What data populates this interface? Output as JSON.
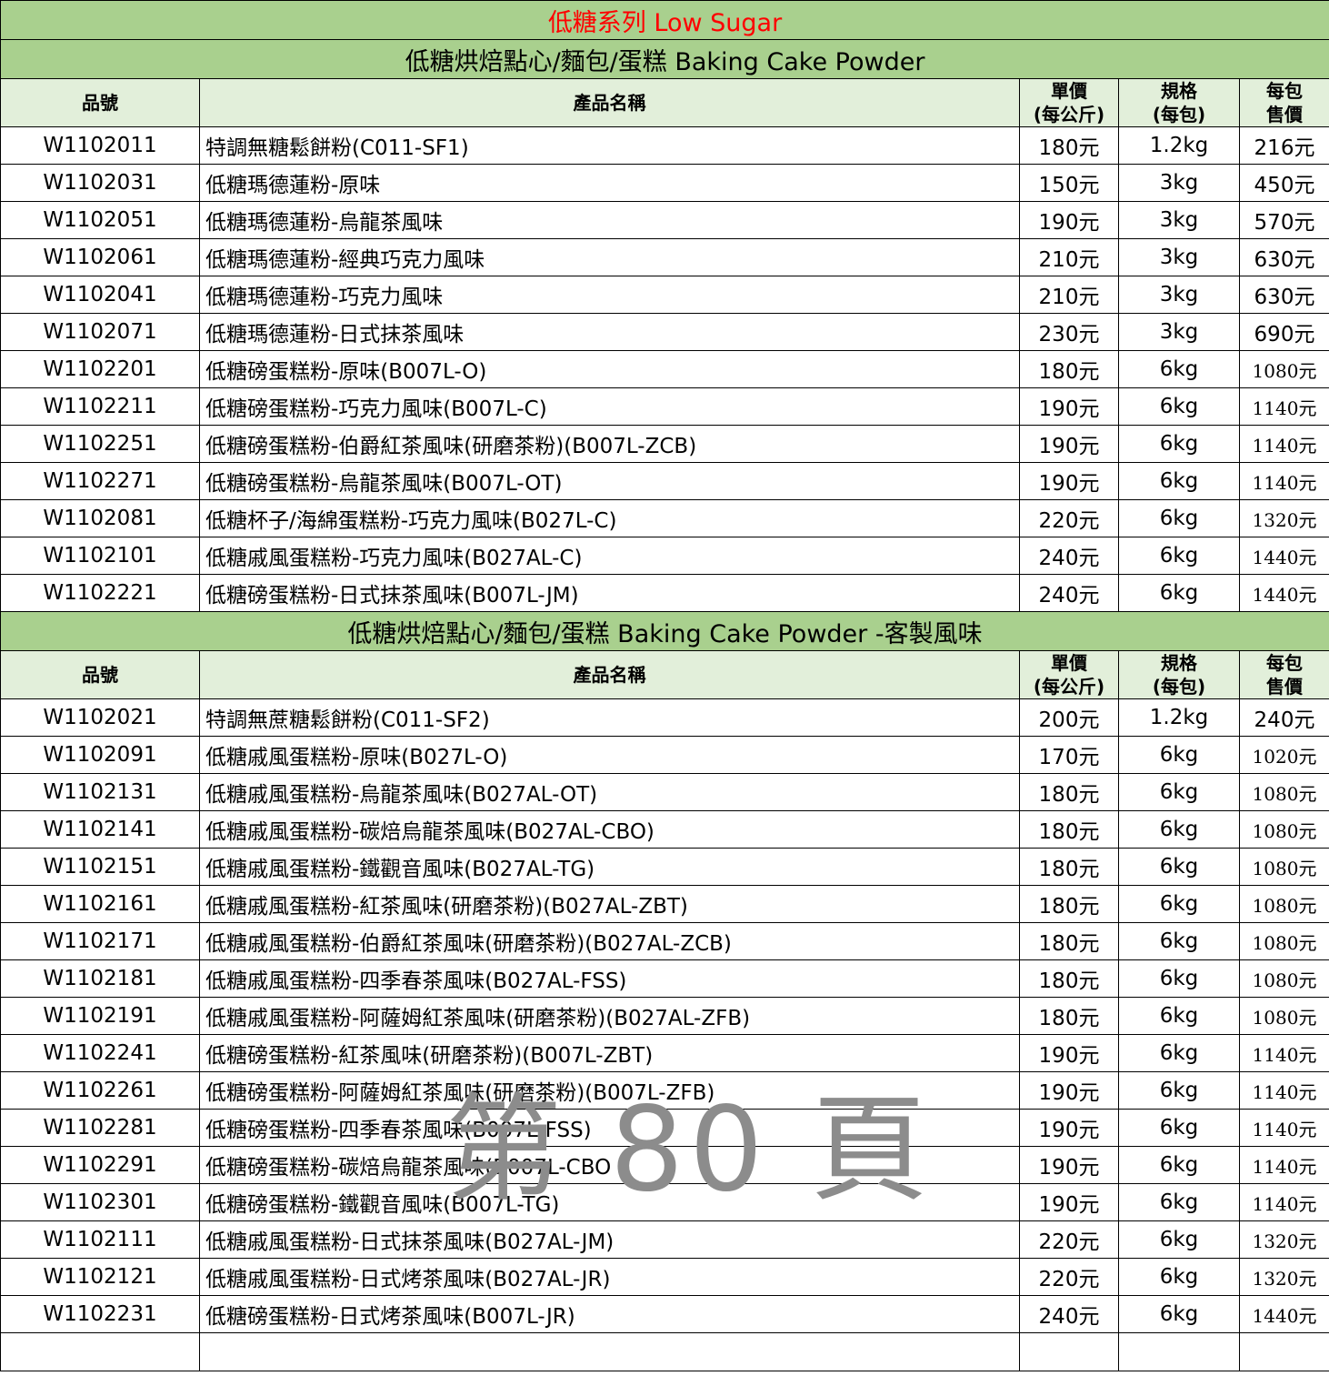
{
  "title": "低糖系列 Low Sugar",
  "columns": {
    "code": "品號",
    "name": "產品名稱",
    "unit_price_1": "單價",
    "unit_price_2": "(每公斤)",
    "spec_1": "規格",
    "spec_2": "(每包)",
    "pack_price_1": "每包",
    "pack_price_2": "售價"
  },
  "sections": [
    {
      "title": "低糖烘焙點心/麵包/蛋糕 Baking Cake Powder",
      "rows": [
        {
          "code": "W1102011",
          "name": "特調無糖鬆餅粉(C011-SF1)",
          "price": "180元",
          "spec": "1.2kg",
          "total": "216元"
        },
        {
          "code": "W1102031",
          "name": "低糖瑪德蓮粉-原味",
          "price": "150元",
          "spec": "3kg",
          "total": "450元"
        },
        {
          "code": "W1102051",
          "name": "低糖瑪德蓮粉-烏龍茶風味",
          "price": "190元",
          "spec": "3kg",
          "total": "570元"
        },
        {
          "code": "W1102061",
          "name": "低糖瑪德蓮粉-經典巧克力風味",
          "price": "210元",
          "spec": "3kg",
          "total": "630元"
        },
        {
          "code": "W1102041",
          "name": "低糖瑪德蓮粉-巧克力風味",
          "price": "210元",
          "spec": "3kg",
          "total": "630元"
        },
        {
          "code": "W1102071",
          "name": "低糖瑪德蓮粉-日式抹茶風味",
          "price": "230元",
          "spec": "3kg",
          "total": "690元"
        },
        {
          "code": "W1102201",
          "name": "低糖磅蛋糕粉-原味(B007L-O)",
          "price": "180元",
          "spec": "6kg",
          "total": "1080元"
        },
        {
          "code": "W1102211",
          "name": "低糖磅蛋糕粉-巧克力風味(B007L-C)",
          "price": "190元",
          "spec": "6kg",
          "total": "1140元"
        },
        {
          "code": "W1102251",
          "name": "低糖磅蛋糕粉-伯爵紅茶風味(研磨茶粉)(B007L-ZCB)",
          "price": "190元",
          "spec": "6kg",
          "total": "1140元"
        },
        {
          "code": "W1102271",
          "name": "低糖磅蛋糕粉-烏龍茶風味(B007L-OT)",
          "price": "190元",
          "spec": "6kg",
          "total": "1140元"
        },
        {
          "code": "W1102081",
          "name": "低糖杯子/海綿蛋糕粉-巧克力風味(B027L-C)",
          "price": "220元",
          "spec": "6kg",
          "total": "1320元"
        },
        {
          "code": "W1102101",
          "name": "低糖戚風蛋糕粉-巧克力風味(B027AL-C)",
          "price": "240元",
          "spec": "6kg",
          "total": "1440元"
        },
        {
          "code": "W1102221",
          "name": "低糖磅蛋糕粉-日式抹茶風味(B007L-JM)",
          "price": "240元",
          "spec": "6kg",
          "total": "1440元"
        }
      ]
    },
    {
      "title": "低糖烘焙點心/麵包/蛋糕 Baking Cake Powder -客製風味",
      "rows": [
        {
          "code": "W1102021",
          "name": "特調無蔗糖鬆餅粉(C011-SF2)",
          "price": "200元",
          "spec": "1.2kg",
          "total": "240元"
        },
        {
          "code": "W1102091",
          "name": "低糖戚風蛋糕粉-原味(B027L-O)",
          "price": "170元",
          "spec": "6kg",
          "total": "1020元"
        },
        {
          "code": "W1102131",
          "name": "低糖戚風蛋糕粉-烏龍茶風味(B027AL-OT)",
          "price": "180元",
          "spec": "6kg",
          "total": "1080元"
        },
        {
          "code": "W1102141",
          "name": "低糖戚風蛋糕粉-碳焙烏龍茶風味(B027AL-CBO)",
          "price": "180元",
          "spec": "6kg",
          "total": "1080元"
        },
        {
          "code": "W1102151",
          "name": "低糖戚風蛋糕粉-鐵觀音風味(B027AL-TG)",
          "price": "180元",
          "spec": "6kg",
          "total": "1080元"
        },
        {
          "code": "W1102161",
          "name": "低糖戚風蛋糕粉-紅茶風味(研磨茶粉)(B027AL-ZBT)",
          "price": "180元",
          "spec": "6kg",
          "total": "1080元"
        },
        {
          "code": "W1102171",
          "name": "低糖戚風蛋糕粉-伯爵紅茶風味(研磨茶粉)(B027AL-ZCB)",
          "price": "180元",
          "spec": "6kg",
          "total": "1080元"
        },
        {
          "code": "W1102181",
          "name": "低糖戚風蛋糕粉-四季春茶風味(B027AL-FSS)",
          "price": "180元",
          "spec": "6kg",
          "total": "1080元"
        },
        {
          "code": "W1102191",
          "name": "低糖戚風蛋糕粉-阿薩姆紅茶風味(研磨茶粉)(B027AL-ZFB)",
          "price": "180元",
          "spec": "6kg",
          "total": "1080元"
        },
        {
          "code": "W1102241",
          "name": "低糖磅蛋糕粉-紅茶風味(研磨茶粉)(B007L-ZBT)",
          "price": "190元",
          "spec": "6kg",
          "total": "1140元"
        },
        {
          "code": "W1102261",
          "name": "低糖磅蛋糕粉-阿薩姆紅茶風味(研磨茶粉)(B007L-ZFB)",
          "price": "190元",
          "spec": "6kg",
          "total": "1140元"
        },
        {
          "code": "W1102281",
          "name": "低糖磅蛋糕粉-四季春茶風味(B007L-FSS)",
          "price": "190元",
          "spec": "6kg",
          "total": "1140元"
        },
        {
          "code": "W1102291",
          "name": "低糖磅蛋糕粉-碳焙烏龍茶風味(B007L-CBO",
          "price": "190元",
          "spec": "6kg",
          "total": "1140元"
        },
        {
          "code": "W1102301",
          "name": "低糖磅蛋糕粉-鐵觀音風味(B007L-TG)",
          "price": "190元",
          "spec": "6kg",
          "total": "1140元"
        },
        {
          "code": "W1102111",
          "name": "低糖戚風蛋糕粉-日式抹茶風味(B027AL-JM)",
          "price": "220元",
          "spec": "6kg",
          "total": "1320元"
        },
        {
          "code": "W1102121",
          "name": "低糖戚風蛋糕粉-日式烤茶風味(B027AL-JR)",
          "price": "220元",
          "spec": "6kg",
          "total": "1320元"
        },
        {
          "code": "W1102231",
          "name": "低糖磅蛋糕粉-日式烤茶風味(B007L-JR)",
          "price": "240元",
          "spec": "6kg",
          "total": "1440元"
        }
      ]
    }
  ],
  "watermark": "第 80 頁",
  "colors": {
    "banner_bg": "#a9d08e",
    "header_bg": "#e2efda",
    "title_text": "#ff0000",
    "watermark": "#8c8c8c"
  }
}
